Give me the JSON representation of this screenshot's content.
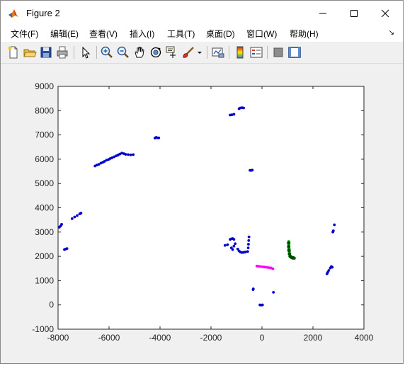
{
  "window": {
    "title": "Figure 2"
  },
  "menu": {
    "items": [
      {
        "label": "文件(F)"
      },
      {
        "label": "编辑(E)"
      },
      {
        "label": "查看(V)"
      },
      {
        "label": "插入(I)"
      },
      {
        "label": "工具(T)"
      },
      {
        "label": "桌面(D)"
      },
      {
        "label": "窗口(W)"
      },
      {
        "label": "帮助(H)"
      }
    ]
  },
  "toolbar": {
    "buttons": [
      "new-figure-icon",
      "open-file-icon",
      "save-icon",
      "print-icon",
      "pointer-icon",
      "zoom-in-icon",
      "zoom-out-icon",
      "pan-icon",
      "rotate-3d-icon",
      "data-cursor-icon",
      "brush-icon",
      "brush-dropdown-icon",
      "link-plot-icon",
      "colorbar-icon",
      "legend-icon",
      "hide-plot-tools-icon",
      "show-plot-tools-icon"
    ]
  },
  "chart_data": {
    "type": "scatter",
    "title": "",
    "xlabel": "",
    "ylabel": "",
    "xlim": [
      -8000,
      4000
    ],
    "ylim": [
      -1000,
      9000
    ],
    "xticks": [
      "-8000",
      "-6000",
      "-4000",
      "-2000",
      "0",
      "2000",
      "4000"
    ],
    "yticks": [
      "-1000",
      "0",
      "1000",
      "2000",
      "3000",
      "4000",
      "5000",
      "6000",
      "7000",
      "8000",
      "9000"
    ],
    "grid": false,
    "series": [
      {
        "color": "#0000d0",
        "points": [
          [
            -7950,
            3200
          ],
          [
            -7900,
            3250
          ],
          [
            -7860,
            3320
          ],
          [
            -7750,
            2280
          ],
          [
            -7700,
            2300
          ],
          [
            -7650,
            2320
          ],
          [
            -7450,
            3550
          ],
          [
            -7350,
            3620
          ],
          [
            -7250,
            3680
          ],
          [
            -7150,
            3750
          ],
          [
            -7100,
            3780
          ],
          [
            -6550,
            5720
          ],
          [
            -6480,
            5760
          ],
          [
            -6400,
            5790
          ],
          [
            -6320,
            5840
          ],
          [
            -6250,
            5870
          ],
          [
            -6180,
            5910
          ],
          [
            -6100,
            5960
          ],
          [
            -6020,
            5990
          ],
          [
            -5950,
            6030
          ],
          [
            -5880,
            6060
          ],
          [
            -5800,
            6100
          ],
          [
            -5720,
            6140
          ],
          [
            -5650,
            6170
          ],
          [
            -5580,
            6210
          ],
          [
            -5500,
            6250
          ],
          [
            -5420,
            6230
          ],
          [
            -5350,
            6200
          ],
          [
            -5250,
            6190
          ],
          [
            -5150,
            6180
          ],
          [
            -5050,
            6190
          ],
          [
            -4200,
            6870
          ],
          [
            -4150,
            6900
          ],
          [
            -4100,
            6880
          ],
          [
            -4050,
            6880
          ],
          [
            -1250,
            7820
          ],
          [
            -1180,
            7830
          ],
          [
            -1100,
            7850
          ],
          [
            -900,
            8080
          ],
          [
            -850,
            8110
          ],
          [
            -780,
            8120
          ],
          [
            -720,
            8110
          ],
          [
            -470,
            5540
          ],
          [
            -420,
            5540
          ],
          [
            -380,
            5550
          ],
          [
            -1450,
            2450
          ],
          [
            -1350,
            2480
          ],
          [
            -1250,
            2700
          ],
          [
            -1200,
            2720
          ],
          [
            -1150,
            2730
          ],
          [
            -1100,
            2700
          ],
          [
            -1200,
            2350
          ],
          [
            -1150,
            2280
          ],
          [
            -1100,
            2420
          ],
          [
            -1050,
            2520
          ],
          [
            -950,
            2300
          ],
          [
            -900,
            2220
          ],
          [
            -850,
            2180
          ],
          [
            -800,
            2160
          ],
          [
            -750,
            2160
          ],
          [
            -700,
            2170
          ],
          [
            -650,
            2180
          ],
          [
            -560,
            2200
          ],
          [
            -540,
            2350
          ],
          [
            -530,
            2500
          ],
          [
            -520,
            2650
          ],
          [
            -510,
            2800
          ],
          [
            -350,
            630
          ],
          [
            -340,
            660
          ],
          [
            -80,
            0
          ],
          [
            -30,
            -10
          ],
          [
            20,
            0
          ],
          [
            450,
            520
          ],
          [
            2550,
            1280
          ],
          [
            2580,
            1340
          ],
          [
            2620,
            1420
          ],
          [
            2680,
            1520
          ],
          [
            2720,
            1580
          ],
          [
            2760,
            1550
          ],
          [
            2780,
            3000
          ],
          [
            2800,
            3050
          ],
          [
            2840,
            3300
          ]
        ]
      },
      {
        "color": "#ff00ff",
        "points": [
          [
            -200,
            1600
          ],
          [
            -130,
            1590
          ],
          [
            -60,
            1580
          ],
          [
            20,
            1570
          ],
          [
            90,
            1560
          ],
          [
            160,
            1550
          ],
          [
            230,
            1540
          ],
          [
            300,
            1530
          ],
          [
            360,
            1520
          ],
          [
            430,
            1490
          ]
        ]
      },
      {
        "color": "#00c800",
        "points": [
          [
            1050,
            2600
          ],
          [
            1050,
            2500
          ],
          [
            1050,
            2400
          ],
          [
            1060,
            2300
          ],
          [
            1070,
            2200
          ],
          [
            1080,
            2100
          ],
          [
            1100,
            2000
          ],
          [
            1150,
            1960
          ],
          [
            1200,
            1930
          ],
          [
            1270,
            1920
          ]
        ]
      },
      {
        "color": "#004400",
        "points": [
          [
            1050,
            2550
          ],
          [
            1050,
            2400
          ],
          [
            1060,
            2250
          ],
          [
            1080,
            2100
          ],
          [
            1110,
            2000
          ],
          [
            1160,
            1960
          ],
          [
            1230,
            1940
          ]
        ]
      }
    ]
  }
}
